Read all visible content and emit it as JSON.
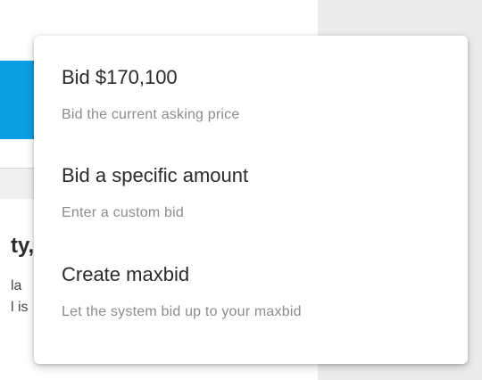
{
  "background": {
    "heading_fragment": "ty,",
    "text_line_1": "la",
    "text_line_2": "l is"
  },
  "bid_menu": {
    "items": [
      {
        "title": "Bid $170,100",
        "description": "Bid the current asking price"
      },
      {
        "title": "Bid a specific amount",
        "description": "Enter a custom bid"
      },
      {
        "title": "Create maxbid",
        "description": "Let the system bid up to your maxbid"
      }
    ]
  },
  "colors": {
    "accent_blue": "#0a9fe0",
    "title_text": "#2a2a2a",
    "description_text": "#8c8c8c",
    "side_panel": "#ececec"
  }
}
